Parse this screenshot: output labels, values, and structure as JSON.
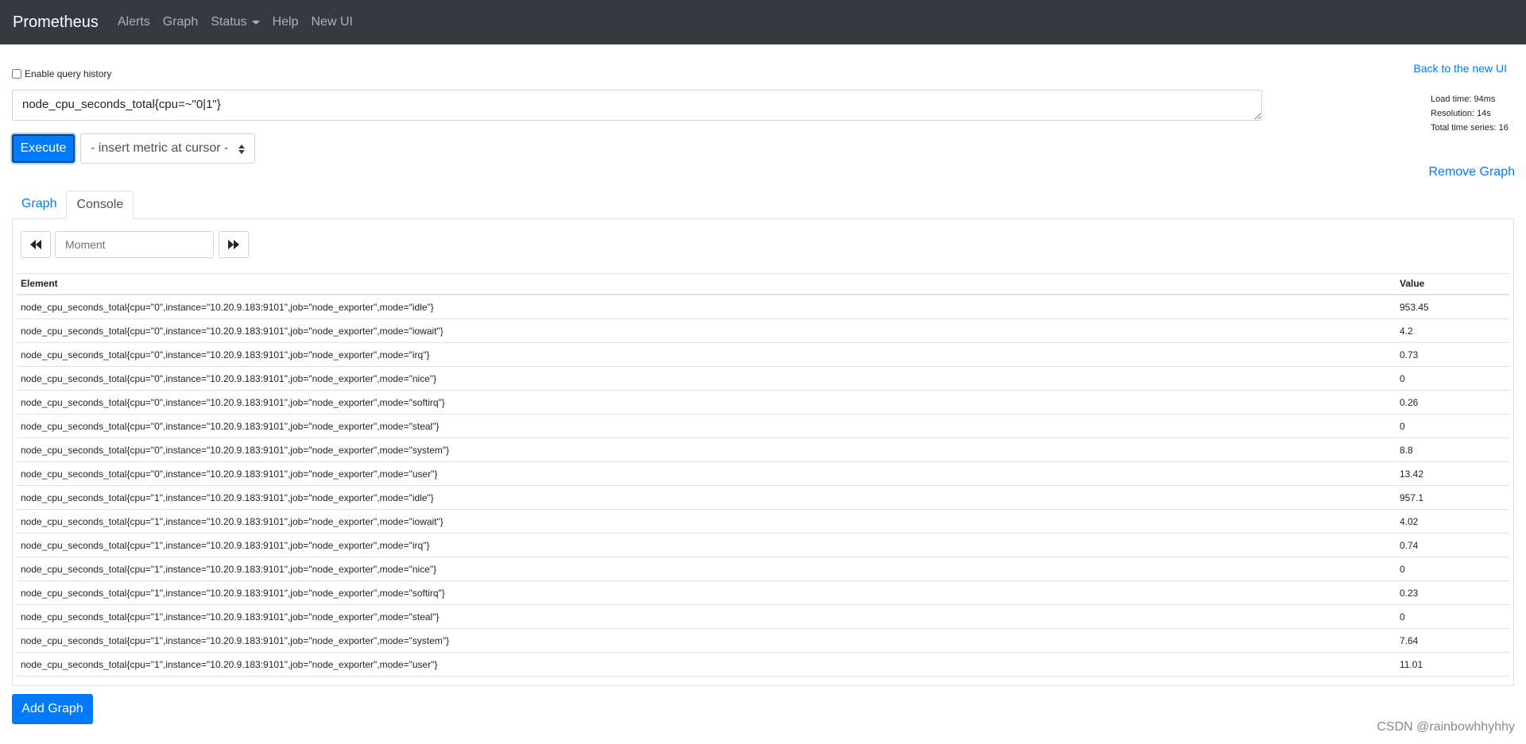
{
  "navbar": {
    "brand": "Prometheus",
    "links": [
      "Alerts",
      "Graph",
      "Status",
      "Help",
      "New UI"
    ]
  },
  "query": {
    "history_label": "Enable query history",
    "expression": "node_cpu_seconds_total{cpu=~\"0|1\"}",
    "execute_label": "Execute",
    "metric_select_label": "- insert metric at cursor -",
    "back_link": "Back to the new UI",
    "remove_graph": "Remove Graph",
    "stats": {
      "load_time": "Load time: 94ms",
      "resolution": "Resolution: 14s",
      "total_series": "Total time series: 16"
    }
  },
  "tabs": {
    "graph": "Graph",
    "console": "Console"
  },
  "console": {
    "moment_placeholder": "Moment",
    "headers": {
      "element": "Element",
      "value": "Value"
    },
    "rows": [
      {
        "element": "node_cpu_seconds_total{cpu=\"0\",instance=\"10.20.9.183:9101\",job=\"node_exporter\",mode=\"idle\"}",
        "value": "953.45"
      },
      {
        "element": "node_cpu_seconds_total{cpu=\"0\",instance=\"10.20.9.183:9101\",job=\"node_exporter\",mode=\"iowait\"}",
        "value": "4.2"
      },
      {
        "element": "node_cpu_seconds_total{cpu=\"0\",instance=\"10.20.9.183:9101\",job=\"node_exporter\",mode=\"irq\"}",
        "value": "0.73"
      },
      {
        "element": "node_cpu_seconds_total{cpu=\"0\",instance=\"10.20.9.183:9101\",job=\"node_exporter\",mode=\"nice\"}",
        "value": "0"
      },
      {
        "element": "node_cpu_seconds_total{cpu=\"0\",instance=\"10.20.9.183:9101\",job=\"node_exporter\",mode=\"softirq\"}",
        "value": "0.26"
      },
      {
        "element": "node_cpu_seconds_total{cpu=\"0\",instance=\"10.20.9.183:9101\",job=\"node_exporter\",mode=\"steal\"}",
        "value": "0"
      },
      {
        "element": "node_cpu_seconds_total{cpu=\"0\",instance=\"10.20.9.183:9101\",job=\"node_exporter\",mode=\"system\"}",
        "value": "8.8"
      },
      {
        "element": "node_cpu_seconds_total{cpu=\"0\",instance=\"10.20.9.183:9101\",job=\"node_exporter\",mode=\"user\"}",
        "value": "13.42"
      },
      {
        "element": "node_cpu_seconds_total{cpu=\"1\",instance=\"10.20.9.183:9101\",job=\"node_exporter\",mode=\"idle\"}",
        "value": "957.1"
      },
      {
        "element": "node_cpu_seconds_total{cpu=\"1\",instance=\"10.20.9.183:9101\",job=\"node_exporter\",mode=\"iowait\"}",
        "value": "4.02"
      },
      {
        "element": "node_cpu_seconds_total{cpu=\"1\",instance=\"10.20.9.183:9101\",job=\"node_exporter\",mode=\"irq\"}",
        "value": "0.74"
      },
      {
        "element": "node_cpu_seconds_total{cpu=\"1\",instance=\"10.20.9.183:9101\",job=\"node_exporter\",mode=\"nice\"}",
        "value": "0"
      },
      {
        "element": "node_cpu_seconds_total{cpu=\"1\",instance=\"10.20.9.183:9101\",job=\"node_exporter\",mode=\"softirq\"}",
        "value": "0.23"
      },
      {
        "element": "node_cpu_seconds_total{cpu=\"1\",instance=\"10.20.9.183:9101\",job=\"node_exporter\",mode=\"steal\"}",
        "value": "0"
      },
      {
        "element": "node_cpu_seconds_total{cpu=\"1\",instance=\"10.20.9.183:9101\",job=\"node_exporter\",mode=\"system\"}",
        "value": "7.64"
      },
      {
        "element": "node_cpu_seconds_total{cpu=\"1\",instance=\"10.20.9.183:9101\",job=\"node_exporter\",mode=\"user\"}",
        "value": "11.01"
      }
    ]
  },
  "add_graph_label": "Add Graph",
  "watermark": "CSDN @rainbowhhyhhy",
  "colors": {
    "navbar": "#343a40",
    "primary": "#007bff"
  },
  "icons": {
    "prev": "fast-backward-icon",
    "next": "fast-forward-icon",
    "dropdown": "caret-down-icon"
  }
}
